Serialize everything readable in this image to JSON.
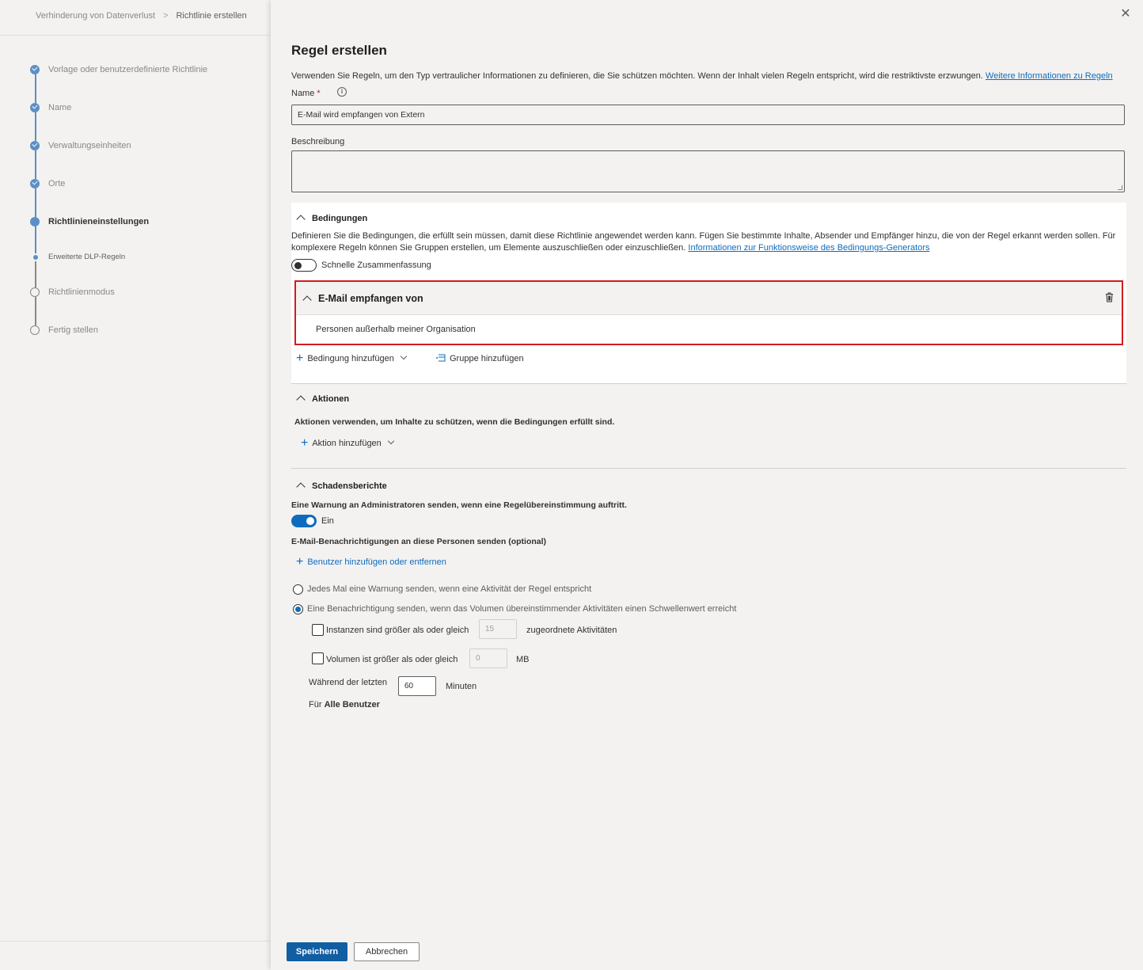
{
  "breadcrumb": {
    "parent": "Verhinderung von Datenverlust",
    "separator": ">",
    "current": "Richtlinie erstellen"
  },
  "steps": [
    {
      "label": "Vorlage oder benutzerdefinierte Richtlinie",
      "state": "done"
    },
    {
      "label": "Name",
      "state": "done"
    },
    {
      "label": "Verwaltungseinheiten",
      "state": "done"
    },
    {
      "label": "Orte",
      "state": "done"
    },
    {
      "label": "Richtlinieneinstellungen",
      "state": "current"
    },
    {
      "label": "Erweiterte DLP-Regeln",
      "state": "sub"
    },
    {
      "label": "Richtlinienmodus",
      "state": "todo"
    },
    {
      "label": "Fertig stellen",
      "state": "todo"
    }
  ],
  "panel": {
    "close": "✕",
    "title": "Regel erstellen",
    "intro": "Verwenden Sie Regeln, um den Typ vertraulicher Informationen zu definieren, die Sie schützen möchten. Wenn der Inhalt vielen Regeln entspricht, wird die restriktivste erzwungen.",
    "intro_link": "Weitere Informationen zu Regeln",
    "name_label": "Name",
    "required_mark": "*",
    "info_icon": "i",
    "name_value": "E-Mail wird empfangen von Extern",
    "description_label": "Beschreibung",
    "description_value": ""
  },
  "conditions": {
    "heading": "Bedingungen",
    "text": "Definieren Sie die Bedingungen, die erfüllt sein müssen, damit diese Richtlinie angewendet werden kann. Fügen Sie bestimmte Inhalte, Absender und Empfänger hinzu, die von der Regel erkannt werden sollen. Für komplexere Regeln können Sie Gruppen erstellen, um Elemente auszuschließen oder einzuschließen.",
    "text_link": "Informationen zur Funktionsweise des Bedingungs-Generators",
    "quick_summary_label": "Schnelle Zusammenfassung",
    "quick_summary_on": false,
    "rule_title": "E-Mail empfangen von",
    "rule_value": "Personen außerhalb meiner Organisation",
    "add_condition": "Bedingung hinzufügen",
    "add_group": "Gruppe hinzufügen"
  },
  "actions": {
    "heading": "Aktionen",
    "text": "Aktionen verwenden, um Inhalte zu schützen, wenn die Bedingungen erfüllt sind.",
    "add_action": "Aktion hinzufügen"
  },
  "reports": {
    "heading": "Schadensberichte",
    "alert_text": "Eine Warnung an Administratoren senden, wenn eine Regelübereinstimmung auftritt.",
    "toggle_label": "Ein",
    "toggle_on": true,
    "email_text": "E-Mail-Benachrichtigungen an diese Personen senden (optional)",
    "add_users": "Benutzer hinzufügen oder entfernen",
    "radio_each": "Jedes Mal eine Warnung senden, wenn eine Aktivität der Regel entspricht",
    "radio_threshold": "Eine Benachrichtigung senden, wenn das Volumen übereinstimmender Aktivitäten einen Schwellenwert erreicht",
    "instances_label": "Instanzen sind größer als oder gleich",
    "instances_value": "15",
    "instances_suffix": "zugeordnete Aktivitäten",
    "volume_label": "Volumen ist größer als oder gleich",
    "volume_value": "0",
    "volume_suffix": "MB",
    "during_label": "Während der letzten",
    "during_value": "60",
    "during_suffix": "Minuten",
    "for_prefix": "Für",
    "for_value": "Alle Benutzer"
  },
  "footer": {
    "save": "Speichern",
    "cancel": "Abbrechen"
  },
  "colors": {
    "accent": "#0f6cbd",
    "primary_button": "#115ea3",
    "highlight_border": "#d11c1c"
  }
}
